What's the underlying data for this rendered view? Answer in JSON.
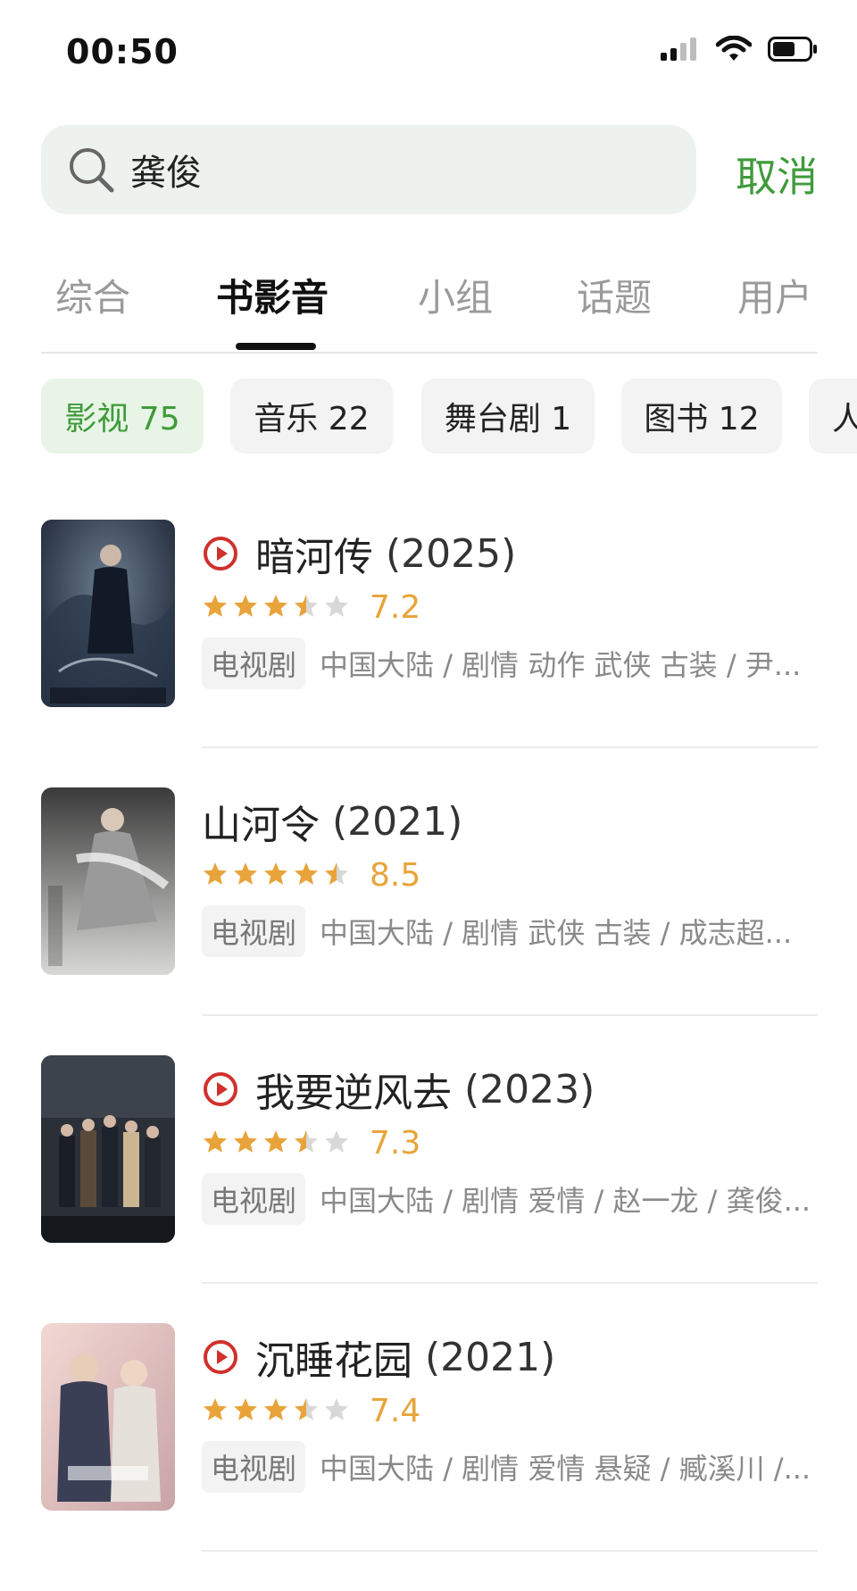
{
  "status_bar": {
    "time": "00:50"
  },
  "search": {
    "query": "龚俊",
    "cancel_label": "取消"
  },
  "tabs": [
    {
      "label": "综合",
      "active": false
    },
    {
      "label": "书影音",
      "active": true
    },
    {
      "label": "小组",
      "active": false
    },
    {
      "label": "话题",
      "active": false
    },
    {
      "label": "用户",
      "active": false
    }
  ],
  "filter_chips": [
    {
      "label": "影视 75",
      "active": true
    },
    {
      "label": "音乐 22",
      "active": false
    },
    {
      "label": "舞台剧 1",
      "active": false
    },
    {
      "label": "图书 12",
      "active": false
    },
    {
      "label": "人",
      "active": false
    }
  ],
  "results": [
    {
      "title": "暗河传",
      "year": "(2025)",
      "has_play": true,
      "rating": 3.5,
      "score": "7.2",
      "type": "电视剧",
      "meta": "中国大陆 / 剧情 动作 武侠 古装 / 尹..."
    },
    {
      "title": "山河令",
      "year": "(2021)",
      "has_play": false,
      "rating": 4.5,
      "score": "8.5",
      "type": "电视剧",
      "meta": "中国大陆 / 剧情 武侠 古装 / 成志超..."
    },
    {
      "title": "我要逆风去",
      "year": "(2023)",
      "has_play": true,
      "rating": 3.5,
      "score": "7.3",
      "type": "电视剧",
      "meta": "中国大陆 / 剧情 爱情 / 赵一龙 / 龚俊..."
    },
    {
      "title": "沉睡花园",
      "year": "(2021)",
      "has_play": true,
      "rating": 3.5,
      "score": "7.4",
      "type": "电视剧",
      "meta": "中国大陆 / 剧情 爱情 悬疑 / 臧溪川 /..."
    }
  ],
  "colors": {
    "accent": "#3f9b3b",
    "star": "#e8a43a",
    "play": "#d0312d"
  }
}
